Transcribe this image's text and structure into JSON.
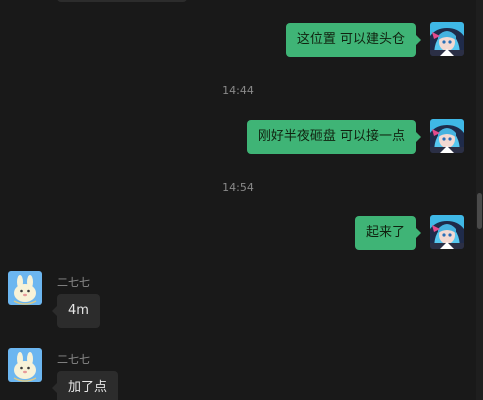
{
  "messages": {
    "m1": "这位置 可以建头仓",
    "t1": "14:44",
    "m2": "刚好半夜砸盘 可以接一点",
    "t2": "14:54",
    "m3": "起来了",
    "o1_name": "二七七",
    "o1_text": "4m",
    "o2_name": "二七七",
    "o2_text": "加了点"
  },
  "colors": {
    "background": "#191919",
    "self_bubble": "#3fb476",
    "other_bubble": "#2c2c2c"
  },
  "icons": {
    "self_avatar": "anime-girl-avatar",
    "other_avatar": "cartoon-rabbit-avatar"
  }
}
